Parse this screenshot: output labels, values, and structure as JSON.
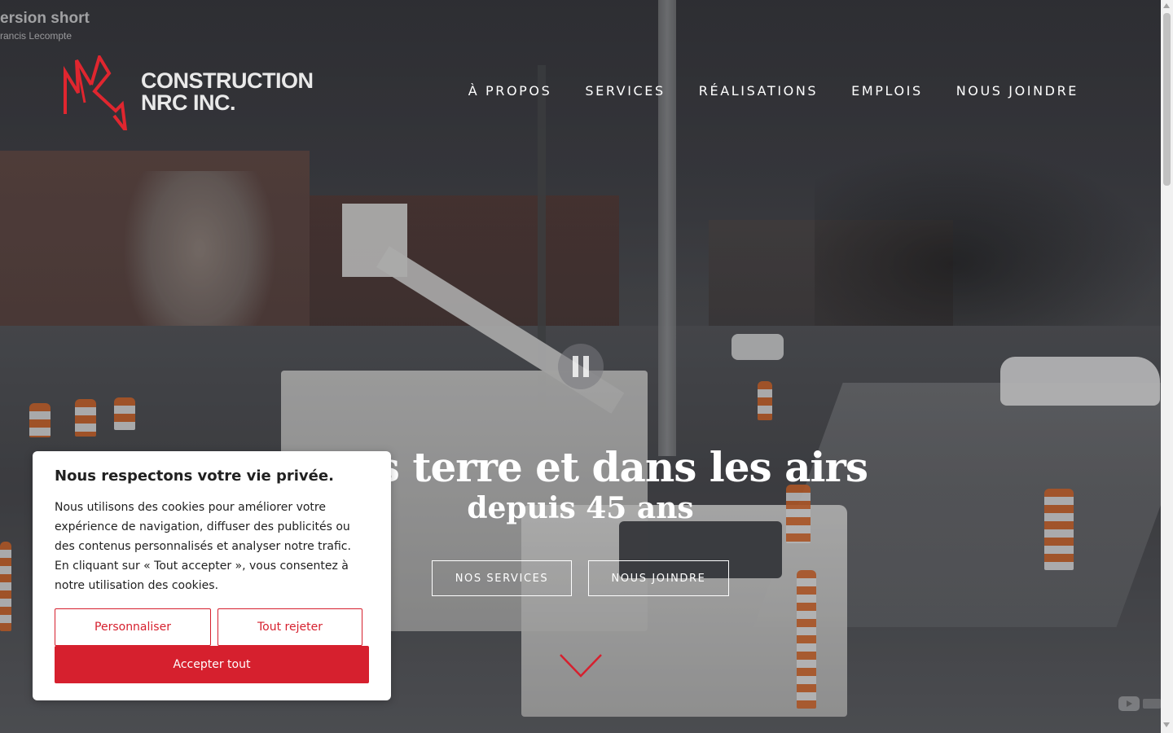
{
  "video": {
    "title": "ersion short",
    "channel": "rancis Lecompte"
  },
  "header": {
    "logo_line1": "CONSTRUCTION",
    "logo_line2": "NRC INC.",
    "nav": [
      {
        "label": "À PROPOS"
      },
      {
        "label": "SERVICES"
      },
      {
        "label": "RÉALISATIONS"
      },
      {
        "label": "EMPLOIS"
      },
      {
        "label": "NOUS JOINDRE"
      }
    ]
  },
  "hero": {
    "title": "Sous terre et dans les airs",
    "subtitle": "depuis 45 ans",
    "btn_services": "NOS SERVICES",
    "btn_contact": "NOUS JOINDRE"
  },
  "cookie": {
    "title": "Nous respectons votre vie privée.",
    "body": "Nous utilisons des cookies pour améliorer votre expérience de navigation, diffuser des publicités ou des contenus personnalisés et analyser notre trafic. En cliquant sur « Tout accepter », vous consentez à notre utilisation des cookies.",
    "customize": "Personnaliser",
    "reject": "Tout rejeter",
    "accept": "Accepter tout"
  },
  "colors": {
    "accent": "#d6202e",
    "logo_red": "#e0262f"
  },
  "icons": [
    "pause-icon",
    "chevron-down-icon",
    "youtube-icon",
    "logo-mark-icon"
  ]
}
